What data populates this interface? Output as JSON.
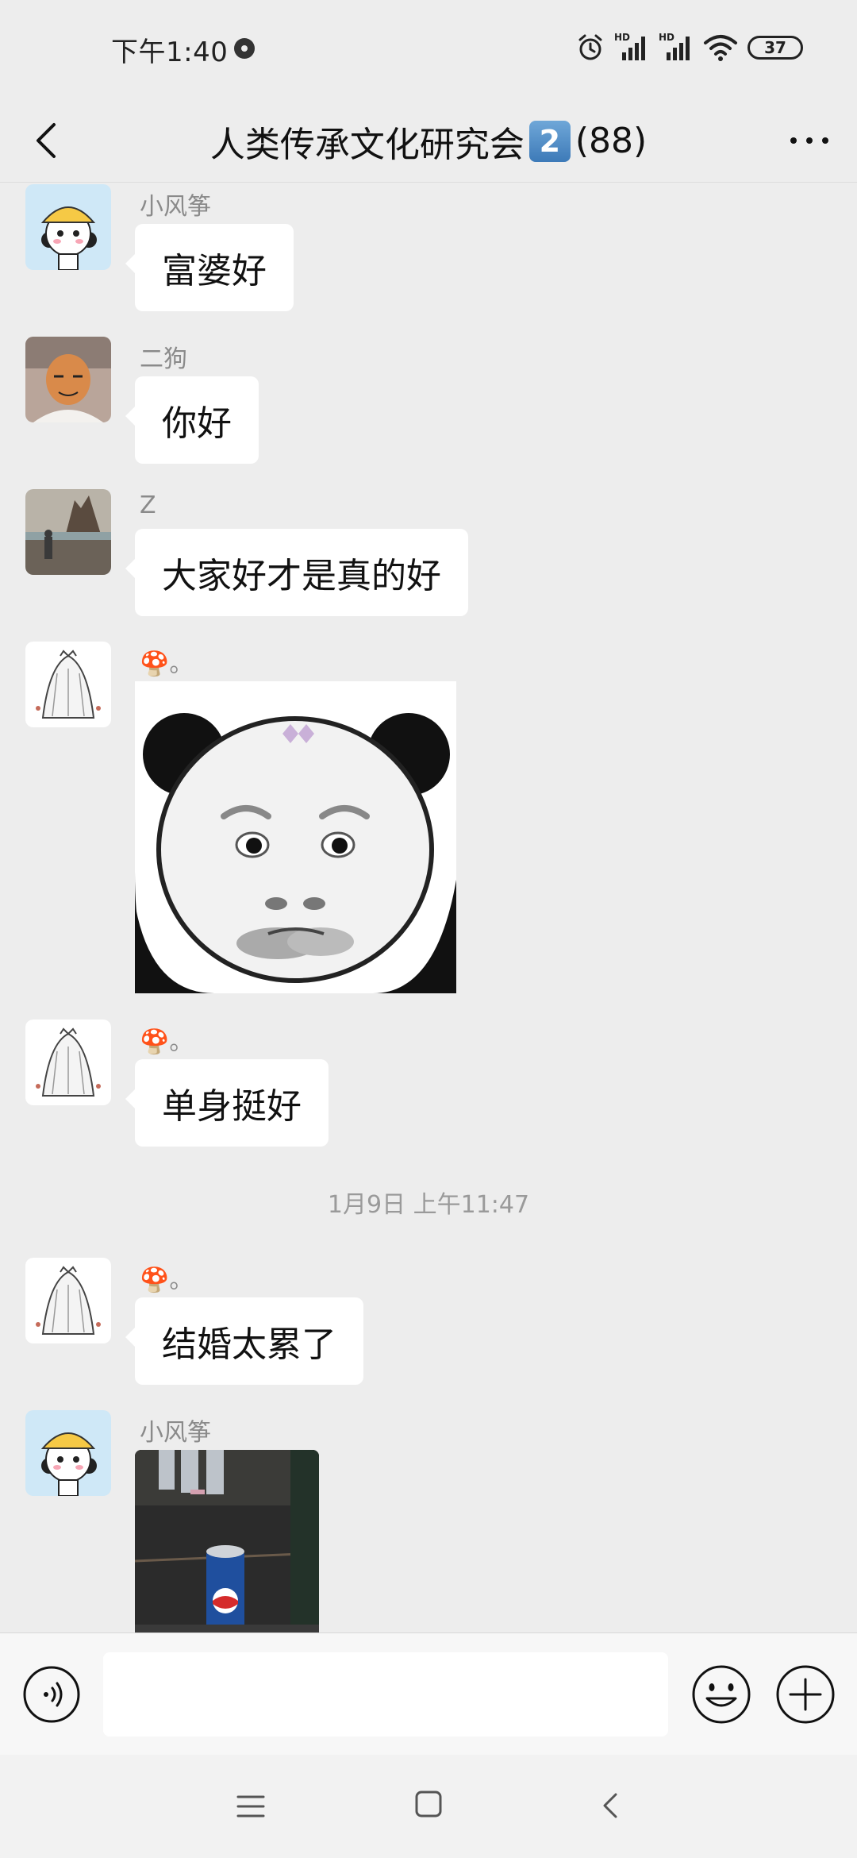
{
  "status_bar": {
    "time": "下午1:40",
    "battery": "37"
  },
  "header": {
    "title_prefix": "人类传承文化研究会",
    "title_badge": "2",
    "member_count": "(88)"
  },
  "messages": [
    {
      "sender": "小风筝",
      "text": "富婆好",
      "avatar": "girl-yellow-hat-avatar"
    },
    {
      "sender": "二狗",
      "text": "你好",
      "avatar": "bald-man-avatar"
    },
    {
      "sender": "Z",
      "text": "大家好才是真的好",
      "avatar": "beach-photo-avatar"
    },
    {
      "sender": "🍄。",
      "image": "panda-face-meme-sticker",
      "avatar": "veil-drawing-avatar"
    },
    {
      "sender": "🍄。",
      "text": "单身挺好",
      "avatar": "veil-drawing-avatar"
    },
    {
      "sender": "🍄。",
      "text": "结婚太累了",
      "avatar": "veil-drawing-avatar"
    },
    {
      "sender": "小风筝",
      "image": "table-photo-with-cola",
      "avatar": "girl-yellow-hat-avatar"
    }
  ],
  "timestamp": "1月9日 上午11:47",
  "input": {
    "value": "",
    "placeholder": ""
  },
  "icons": {
    "back": "chevron-left-icon",
    "more": "more-dots-icon",
    "voice": "voice-icon",
    "emoji": "emoji-icon",
    "plus": "plus-icon"
  },
  "colors": {
    "background": "#ededed",
    "bubble": "#ffffff",
    "sender_text": "#8a8a8a"
  }
}
